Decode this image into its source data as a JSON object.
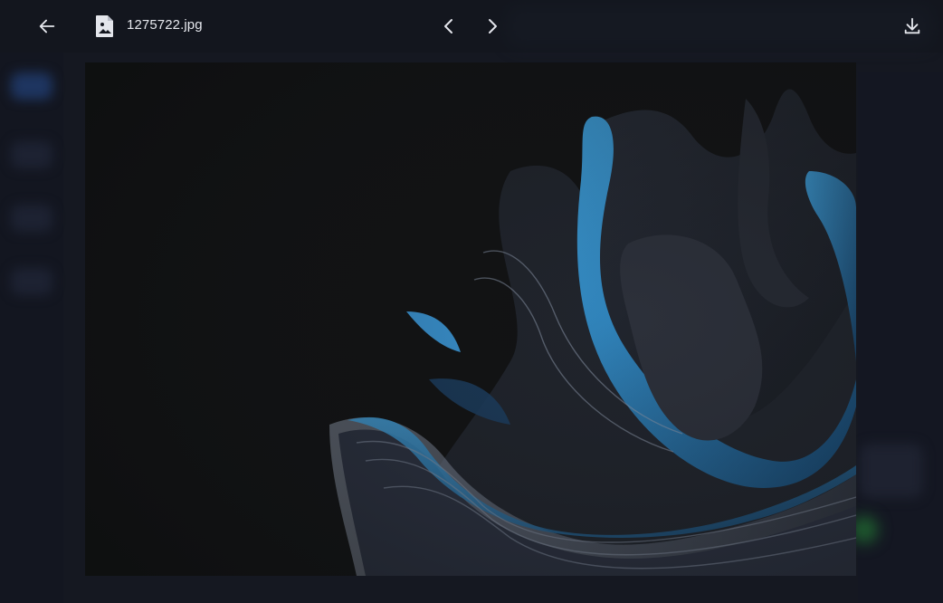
{
  "viewer": {
    "filename": "1275722.jpg",
    "back_icon": "arrow-left-icon",
    "file_icon": "image-file-icon",
    "prev_icon": "chevron-left-icon",
    "next_icon": "chevron-right-icon",
    "download_icon": "download-icon"
  },
  "image": {
    "description_colors": {
      "background": "#111213",
      "accent_blue": "#2f8fd0",
      "petal_dark": "#1f232b",
      "petal_light": "#8c97ab"
    }
  },
  "colors": {
    "bar": "#13161e",
    "text": "#e6e8ee",
    "icon": "#e4e6ec"
  }
}
